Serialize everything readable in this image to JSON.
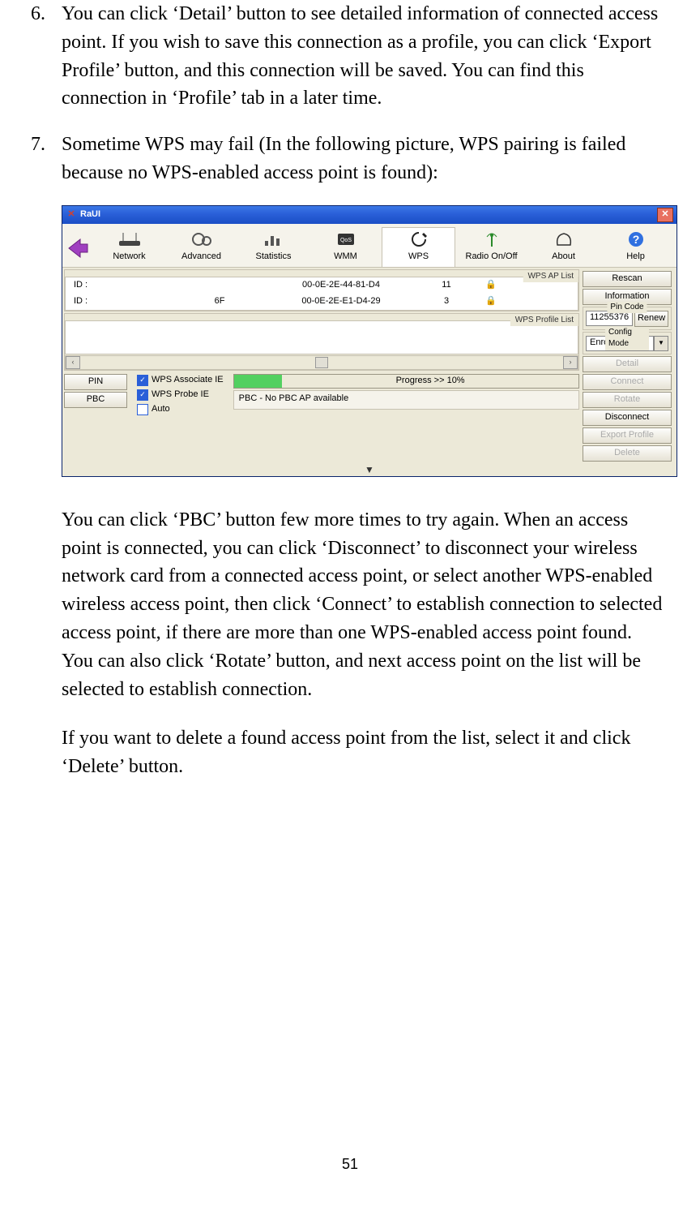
{
  "items": {
    "i6": {
      "num": "6.",
      "text": "You can click ‘Detail’ button to see detailed information of connected access point. If you wish to save this connection as a profile, you can click ‘Export Profile’ button, and this connection will be saved. You can find this connection in ‘Profile’ tab in a later time."
    },
    "i7": {
      "num": "7.",
      "text": "Sometime WPS may fail (In the following picture, WPS pairing is failed because no WPS-enabled access point is found):"
    }
  },
  "after1": "You can click ‘PBC’ button few more times to try again. When an access point is connected, you can click ‘Disconnect’ to disconnect your wireless network card from a connected access point, or select another WPS-enabled wireless access point, then click ‘Connect’ to establish connection to selected access point, if there are more than one WPS-enabled access point found. You can also click ‘Rotate’ button, and next access point on the list will be selected to establish connection.",
  "after2": "If you want to delete a found access point from the list, select it and click ‘Delete’ button.",
  "pageno": "51",
  "win": {
    "title": "RaUI",
    "tabs": {
      "network": "Network",
      "advanced": "Advanced",
      "statistics": "Statistics",
      "wmm": "WMM",
      "wps": "WPS",
      "radio": "Radio On/Off",
      "about": "About",
      "help": "Help"
    },
    "aplist_legend": "WPS AP List",
    "profilelist_legend": "WPS Profile List",
    "ap": [
      {
        "id": "ID :",
        "name": "",
        "mac": "00-0E-2E-44-81-D4",
        "ch": "11"
      },
      {
        "id": "ID :",
        "name": "6F",
        "mac": "00-0E-2E-E1-D4-29",
        "ch": "3"
      }
    ],
    "btn_pin": "PIN",
    "btn_pbc": "PBC",
    "chk_assoc": "WPS Associate IE",
    "chk_probe": "WPS Probe IE",
    "chk_auto": "Auto",
    "progress_label": "Progress >> 10%",
    "progress_status": "PBC - No PBC AP available",
    "r": {
      "rescan": "Rescan",
      "info": "Information",
      "pincode_lg": "Pin Code",
      "pincode": "11255376",
      "renew": "Renew",
      "config_lg": "Config Mode",
      "config_val": "Enrollee",
      "detail": "Detail",
      "connect": "Connect",
      "rotate": "Rotate",
      "disconnect": "Disconnect",
      "export": "Export Profile",
      "delete": "Delete"
    },
    "scroll": {
      "left": "‹",
      "right": "›"
    }
  }
}
